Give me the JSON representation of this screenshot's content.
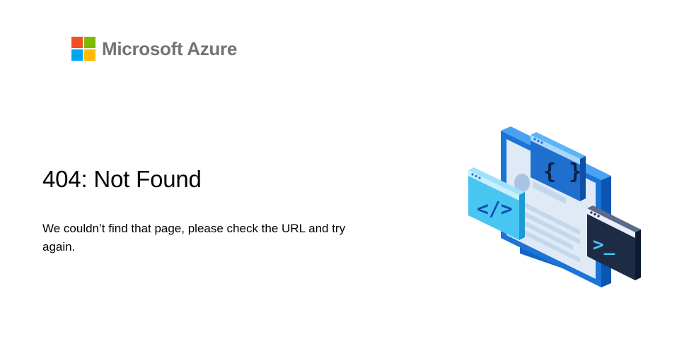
{
  "brand": {
    "name": "Microsoft Azure",
    "logo_colors": [
      "#f25022",
      "#7fba00",
      "#00a4ef",
      "#ffb900"
    ]
  },
  "error": {
    "title": "404: Not Found",
    "message": "We couldn’t find that page, please check the URL and try again."
  },
  "illustration": {
    "icons": [
      "code-brackets-icon",
      "curly-braces-icon",
      "terminal-prompt-icon"
    ],
    "colors": {
      "monitor": "#0f6bd1",
      "screen": "#dfeaf6",
      "code_window": "#49c5f2",
      "json_window": "#1f6fcf",
      "terminal_window": "#1d2b45"
    }
  }
}
